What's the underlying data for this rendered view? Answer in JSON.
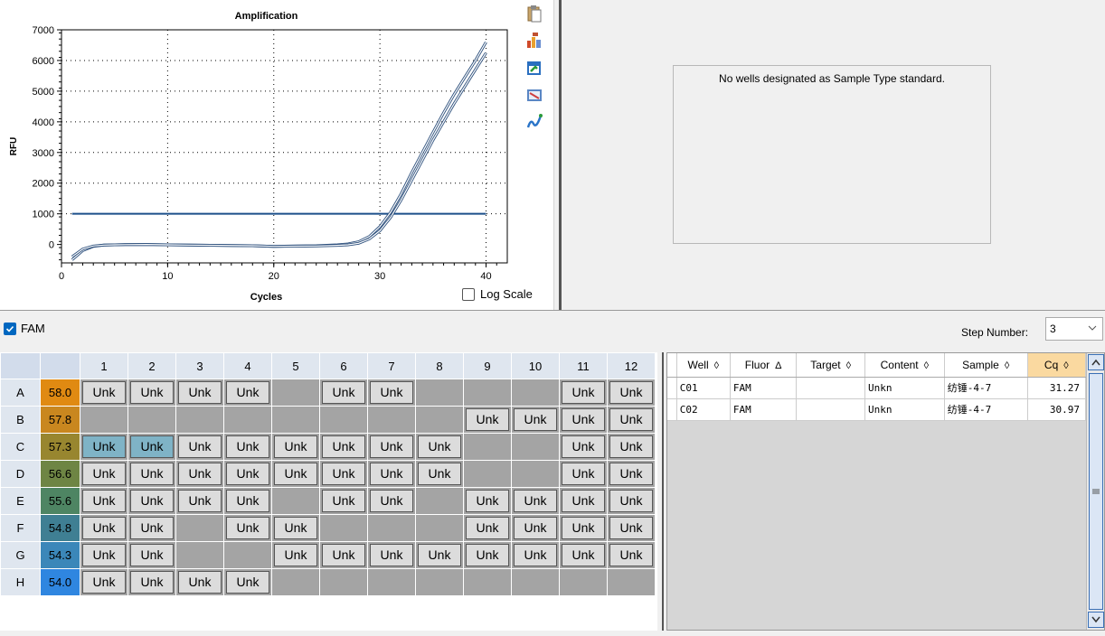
{
  "chart_data": {
    "type": "line",
    "title": "Amplification",
    "xlabel": "Cycles",
    "ylabel": "RFU",
    "xlim": [
      0,
      42
    ],
    "ylim": [
      -600,
      7000
    ],
    "x_ticks": [
      0,
      10,
      20,
      30,
      40
    ],
    "y_ticks": [
      0,
      1000,
      2000,
      3000,
      4000,
      5000,
      6000,
      7000
    ],
    "grid": "dotted",
    "threshold": 1000,
    "series": [
      {
        "x": [
          1,
          2,
          3,
          4,
          5,
          6,
          8,
          10,
          12,
          15,
          18,
          20,
          22,
          24,
          26,
          27,
          28,
          29,
          30,
          31,
          32,
          33,
          34,
          35,
          36,
          37,
          38,
          39,
          40
        ],
        "values": [
          -500,
          -200,
          -60,
          -20,
          -10,
          -5,
          0,
          -10,
          -20,
          -30,
          -40,
          -60,
          -50,
          -40,
          -10,
          20,
          90,
          260,
          580,
          1050,
          1650,
          2350,
          3000,
          3650,
          4300,
          4900,
          5450,
          6000,
          6600
        ]
      },
      {
        "x": [
          1,
          2,
          3,
          4,
          5,
          6,
          8,
          10,
          12,
          15,
          18,
          20,
          22,
          24,
          26,
          27,
          28,
          29,
          30,
          31,
          32,
          33,
          34,
          35,
          36,
          37,
          38,
          39,
          40
        ],
        "values": [
          -400,
          -150,
          -50,
          -20,
          -10,
          -5,
          0,
          -10,
          -20,
          -30,
          -40,
          -60,
          -55,
          -50,
          -30,
          -10,
          40,
          180,
          450,
          880,
          1450,
          2100,
          2750,
          3400,
          4000,
          4600,
          5150,
          5700,
          6250
        ]
      }
    ],
    "colors": {
      "line": "#7090b8",
      "threshold": "#1c4f8a"
    }
  },
  "toolbar": {
    "icons": [
      "clipboard-icon",
      "chart-export-icon",
      "refresh-export-icon",
      "zoom-graph-icon",
      "trace-icon"
    ]
  },
  "log_scale_label": "Log Scale",
  "standard_message": "No wells designated as Sample Type standard.",
  "fluor": {
    "label": "FAM",
    "checked": true
  },
  "step": {
    "label": "Step Number:",
    "value": "3"
  },
  "plate": {
    "columns": [
      "1",
      "2",
      "3",
      "4",
      "5",
      "6",
      "7",
      "8",
      "9",
      "10",
      "11",
      "12"
    ],
    "rows": [
      {
        "label": "A",
        "temp": "58.0",
        "color": "#e08a12",
        "wells": [
          1,
          1,
          1,
          1,
          0,
          1,
          1,
          0,
          0,
          0,
          1,
          1
        ]
      },
      {
        "label": "B",
        "temp": "57.8",
        "color": "#c9871f",
        "wells": [
          0,
          0,
          0,
          0,
          0,
          0,
          0,
          0,
          1,
          1,
          1,
          1
        ]
      },
      {
        "label": "C",
        "temp": "57.3",
        "color": "#98862f",
        "wells": [
          2,
          2,
          1,
          1,
          1,
          1,
          1,
          1,
          0,
          0,
          1,
          1
        ]
      },
      {
        "label": "D",
        "temp": "56.6",
        "color": "#6e8544",
        "wells": [
          1,
          1,
          1,
          1,
          1,
          1,
          1,
          1,
          0,
          0,
          1,
          1
        ]
      },
      {
        "label": "E",
        "temp": "55.6",
        "color": "#4e8563",
        "wells": [
          1,
          1,
          1,
          1,
          0,
          1,
          1,
          0,
          1,
          1,
          1,
          1
        ]
      },
      {
        "label": "F",
        "temp": "54.8",
        "color": "#3f7f93",
        "wells": [
          1,
          1,
          0,
          1,
          1,
          0,
          0,
          0,
          1,
          1,
          1,
          1
        ]
      },
      {
        "label": "G",
        "temp": "54.3",
        "color": "#3b87b9",
        "wells": [
          1,
          1,
          0,
          0,
          1,
          1,
          1,
          1,
          1,
          1,
          1,
          1
        ]
      },
      {
        "label": "H",
        "temp": "54.0",
        "color": "#2f86e0",
        "wells": [
          1,
          1,
          1,
          1,
          0,
          0,
          0,
          0,
          0,
          0,
          0,
          0
        ]
      }
    ],
    "well_label": "Unk"
  },
  "results_table": {
    "columns": [
      {
        "label": "Well",
        "sort": "◊"
      },
      {
        "label": "Fluor",
        "sort": "Δ"
      },
      {
        "label": "Target",
        "sort": "◊"
      },
      {
        "label": "Content",
        "sort": "◊"
      },
      {
        "label": "Sample",
        "sort": "◊"
      },
      {
        "label": "Cq",
        "sort": "◊"
      }
    ],
    "rows": [
      {
        "well": "C01",
        "fluor": "FAM",
        "target": "",
        "content": "Unkn",
        "sample": "纺锤-4-7",
        "cq": "31.27"
      },
      {
        "well": "C02",
        "fluor": "FAM",
        "target": "",
        "content": "Unkn",
        "sample": "纺锤-4-7",
        "cq": "30.97"
      }
    ]
  }
}
